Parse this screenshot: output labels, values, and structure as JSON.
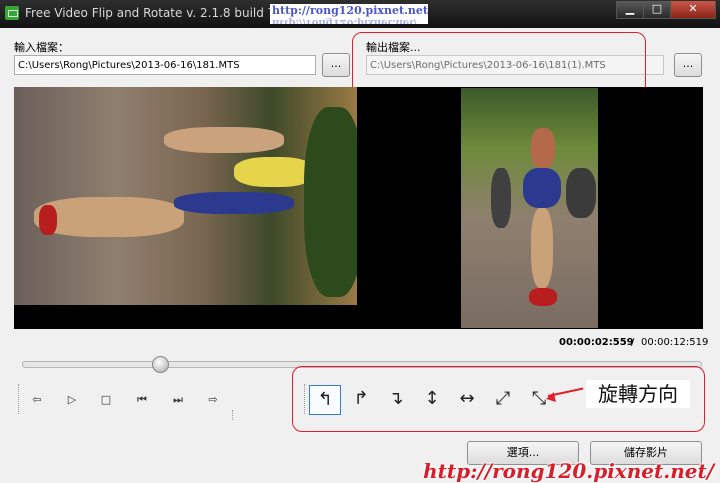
{
  "window": {
    "title": "Free Video Flip and Rotate  v. 2.1.8 build 711",
    "watermark_top": "http://rong120.pixnet.net/",
    "buttons": {
      "minimize": "▁",
      "maximize": "□",
      "close": "✕"
    }
  },
  "input": {
    "label": "輸入檔案：",
    "path": "C:\\Users\\Rong\\Pictures\\2013-06-16\\181.MTS",
    "browse_label": "..."
  },
  "output": {
    "label": "輸出檔案...",
    "path": "C:\\Users\\Rong\\Pictures\\2013-06-16\\181(1).MTS",
    "browse_label": "..."
  },
  "playback": {
    "current_time": "00:00:02:559",
    "separator": "/",
    "total_time": "00:00:12:519",
    "position_fraction": 0.2
  },
  "controls": {
    "prev": "⇦",
    "play": "▷",
    "stop": "□",
    "skip_back": "⏮",
    "skip_forward": "⏭",
    "next": "⇨"
  },
  "rotate_buttons": [
    {
      "name": "rotate-ccw-90",
      "glyph": "↰"
    },
    {
      "name": "rotate-cw-90",
      "glyph": "↱"
    },
    {
      "name": "rotate-180",
      "glyph": "↴"
    },
    {
      "name": "flip-vertical",
      "glyph": "↕"
    },
    {
      "name": "flip-horizontal",
      "glyph": "↔"
    },
    {
      "name": "transpose",
      "glyph": "⤢"
    },
    {
      "name": "transverse",
      "glyph": "⤡"
    }
  ],
  "annotation": "旋轉方向",
  "footer": {
    "options_label": "選項...",
    "save_label": "儲存影片",
    "watermark": "http://rong120.pixnet.net/"
  },
  "colors": {
    "annotation_red": "#e0202c",
    "watermark_blue": "#4a56c9"
  }
}
